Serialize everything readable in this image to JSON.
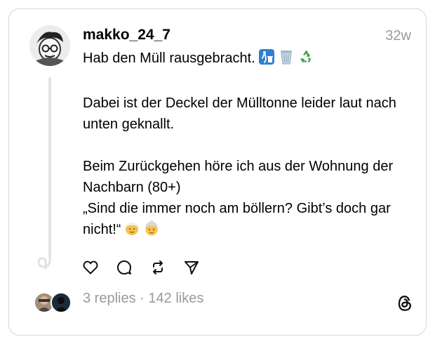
{
  "post": {
    "username": "makko_24_7",
    "timestamp": "32w",
    "lines": [
      "Hab den Müll rausgebracht.",
      "Dabei ist der Deckel der Mülltonne leider laut nach unten geknallt.",
      "Beim Zurückgehen höre ich aus der Wohnung der Nachbarn (80+)",
      "„Sind die immer noch am böllern? Gibt’s doch gar nicht!“"
    ],
    "emojis_line1": [
      "litter-bin-sign-icon",
      "wastebasket-icon",
      "recycling-icon"
    ],
    "emojis_last": [
      "older-man-icon",
      "older-woman-icon"
    ]
  },
  "stats": {
    "replies": "3 replies",
    "separator": " · ",
    "likes": "142 likes"
  },
  "colors": {
    "muted": "#9a9a9a",
    "border": "#d6d6d6",
    "thread_line": "#e3e3e3",
    "recycle_green": "#3aa34a",
    "sign_blue": "#2f7fd3"
  }
}
